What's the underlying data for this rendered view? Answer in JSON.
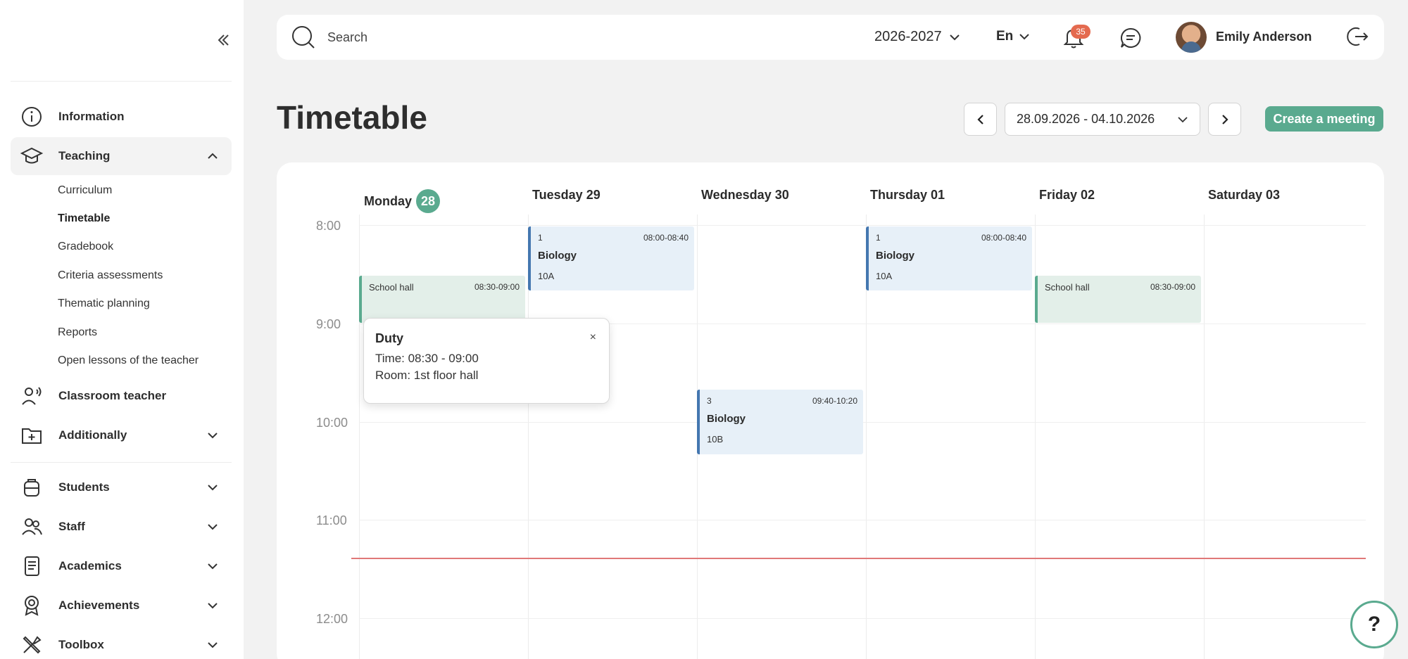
{
  "sidebar": {
    "collapse_icon": "double-chevron-left-icon",
    "items": [
      {
        "label": "Information",
        "icon": "info-icon"
      },
      {
        "label": "Teaching",
        "icon": "graduation-cap-icon"
      },
      {
        "label": "Classroom teacher",
        "icon": "users-voice-icon"
      },
      {
        "label": "Additionally",
        "icon": "folder-plus-icon"
      },
      {
        "label": "Students",
        "icon": "backpack-icon"
      },
      {
        "label": "Staff",
        "icon": "staff-icon"
      },
      {
        "label": "Academics",
        "icon": "document-icon"
      },
      {
        "label": "Achievements",
        "icon": "medal-icon"
      },
      {
        "label": "Toolbox",
        "icon": "tools-icon"
      }
    ],
    "teaching_sub": [
      "Curriculum",
      "Timetable",
      "Gradebook",
      "Criteria assessments",
      "Thematic planning",
      "Reports",
      "Open lessons of the teacher"
    ]
  },
  "topbar": {
    "search_placeholder": "Search",
    "year": "2026-2027",
    "language": "En",
    "notifications_count": "35",
    "user_name": "Emily Anderson"
  },
  "page": {
    "title": "Timetable",
    "date_range": "28.09.2026 - 04.10.2026",
    "create_label": "Create a meeting"
  },
  "calendar": {
    "days": [
      {
        "name": "Monday",
        "num": "28"
      },
      {
        "name": "Tuesday 29"
      },
      {
        "name": "Wednesday 30"
      },
      {
        "name": "Thursday 01"
      },
      {
        "name": "Friday 02"
      },
      {
        "name": "Saturday 03"
      }
    ],
    "times": [
      "8:00",
      "9:00",
      "10:00",
      "11:00",
      "12:00"
    ],
    "events": [
      {
        "num": "1",
        "time": "08:00-08:40",
        "subject": "Biology",
        "class": "10A"
      },
      {
        "num": "1",
        "time": "08:00-08:40",
        "subject": "Biology",
        "class": "10A"
      },
      {
        "num": "3",
        "time": "09:40-10:20",
        "subject": "Biology",
        "class": "10B"
      }
    ],
    "duties": [
      {
        "place": "School hall",
        "time": "08:30-09:00"
      },
      {
        "place": "School hall",
        "time": "08:30-09:00"
      }
    ],
    "popup": {
      "title": "Duty",
      "close": "×",
      "time_line": "Time: 08:30 - 09:00",
      "room_line": "Room: 1st floor hall"
    }
  },
  "help": {
    "label": "?"
  },
  "colors": {
    "accent": "#5aaa8f",
    "lesson": "#4477b0",
    "now_line": "#e07878",
    "badge": "#e46a4f"
  }
}
